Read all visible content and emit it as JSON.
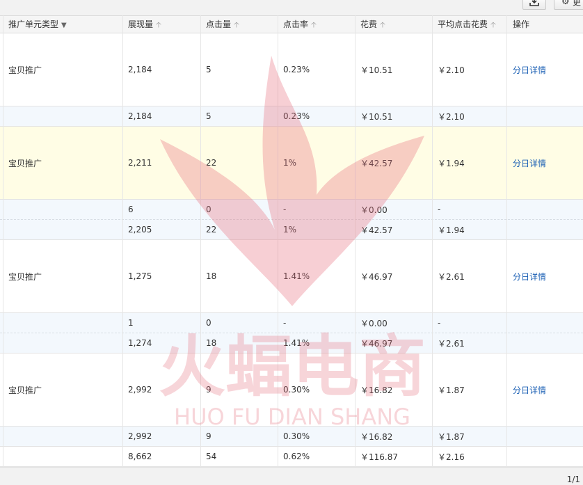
{
  "toolbar": {
    "export_icon": "download-icon",
    "settings_icon": "gear-icon",
    "settings_label": "更"
  },
  "columns": [
    "推广单元类型",
    "展现量",
    "点击量",
    "点击率",
    "花费",
    "平均点击花费",
    "操作"
  ],
  "rows": [
    {
      "kind": "main",
      "type": "宝贝推广",
      "impressions": "2,184",
      "clicks": "5",
      "ctr": "0.23%",
      "cost": "￥10.51",
      "cpc": "￥2.10",
      "action": "分日详情"
    },
    {
      "kind": "sub",
      "impressions": "2,184",
      "clicks": "5",
      "ctr": "0.23%",
      "cost": "￥10.51",
      "cpc": "￥2.10"
    },
    {
      "kind": "main",
      "type": "宝贝推广",
      "impressions": "2,211",
      "clicks": "22",
      "ctr": "1%",
      "cost": "￥42.57",
      "cpc": "￥1.94",
      "action": "分日详情"
    },
    {
      "kind": "sub",
      "impressions": "6",
      "clicks": "0",
      "ctr": "-",
      "cost": "￥0.00",
      "cpc": "-"
    },
    {
      "kind": "sub",
      "impressions": "2,205",
      "clicks": "22",
      "ctr": "1%",
      "cost": "￥42.57",
      "cpc": "￥1.94"
    },
    {
      "kind": "main",
      "type": "宝贝推广",
      "impressions": "1,275",
      "clicks": "18",
      "ctr": "1.41%",
      "cost": "￥46.97",
      "cpc": "￥2.61",
      "action": "分日详情"
    },
    {
      "kind": "sub",
      "impressions": "1",
      "clicks": "0",
      "ctr": "-",
      "cost": "￥0.00",
      "cpc": "-"
    },
    {
      "kind": "sub",
      "impressions": "1,274",
      "clicks": "18",
      "ctr": "1.41%",
      "cost": "￥46.97",
      "cpc": "￥2.61"
    },
    {
      "kind": "main",
      "type": "宝贝推广",
      "impressions": "2,992",
      "clicks": "9",
      "ctr": "0.30%",
      "cost": "￥16.82",
      "cpc": "￥1.87",
      "action": "分日详情"
    },
    {
      "kind": "sub",
      "impressions": "2,992",
      "clicks": "9",
      "ctr": "0.30%",
      "cost": "￥16.82",
      "cpc": "￥1.87"
    }
  ],
  "total": {
    "impressions": "8,662",
    "clicks": "54",
    "ctr": "0.62%",
    "cost": "￥116.87",
    "cpc": "￥2.16"
  },
  "pager": {
    "label": "1/1"
  },
  "watermark": {
    "title": "火蝠电商",
    "subtitle": "HUO FU DIAN SHANG",
    "color": "#e8a0a8"
  }
}
